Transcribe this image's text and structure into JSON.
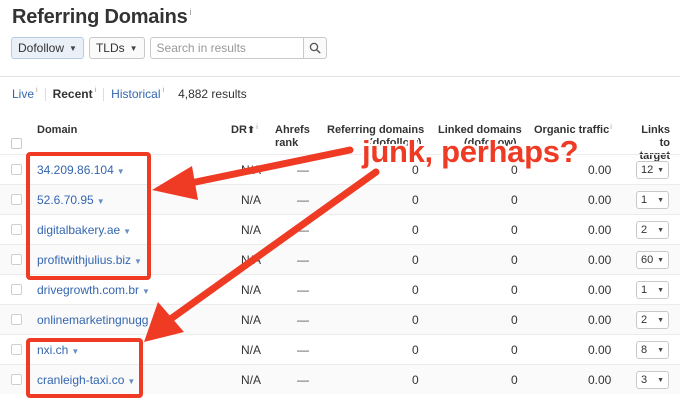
{
  "header": {
    "title": "Referring Domains",
    "info": "i"
  },
  "filters": {
    "dofollow_label": "Dofollow",
    "tlds_label": "TLDs",
    "search_placeholder": "Search in results"
  },
  "modes": {
    "live": "Live",
    "recent": "Recent",
    "historical": "Historical",
    "info": "i",
    "results": "4,882 results"
  },
  "columns": {
    "domain": "Domain",
    "dr": "DR",
    "ahrefs_rank": [
      "Ahrefs",
      "rank"
    ],
    "referring_domains": [
      "Referring domains",
      "(dofollow)"
    ],
    "linked_domains": [
      "Linked domains",
      "(dofollow)"
    ],
    "organic_traffic": "Organic traffic",
    "links_to_target": [
      "Links to",
      "target"
    ]
  },
  "rows": [
    {
      "domain": "34.209.86.104",
      "dr": "N/A",
      "rank": "—",
      "ref": "0",
      "linked": "0",
      "traffic": "0.00",
      "links": "12"
    },
    {
      "domain": "52.6.70.95",
      "dr": "N/A",
      "rank": "—",
      "ref": "0",
      "linked": "0",
      "traffic": "0.00",
      "links": "1"
    },
    {
      "domain": "digitalbakery.ae",
      "dr": "N/A",
      "rank": "—",
      "ref": "0",
      "linked": "0",
      "traffic": "0.00",
      "links": "2"
    },
    {
      "domain": "profitwithjulius.biz",
      "dr": "N/A",
      "rank": "—",
      "ref": "0",
      "linked": "0",
      "traffic": "0.00",
      "links": "60"
    },
    {
      "domain": "drivegrowth.com.br",
      "dr": "N/A",
      "rank": "—",
      "ref": "0",
      "linked": "0",
      "traffic": "0.00",
      "links": "1"
    },
    {
      "domain": "onlinemarketingnugg",
      "dr": "N/A",
      "rank": "—",
      "ref": "0",
      "linked": "0",
      "traffic": "0.00",
      "links": "2"
    },
    {
      "domain": "nxi.ch",
      "dr": "N/A",
      "rank": "—",
      "ref": "0",
      "linked": "0",
      "traffic": "0.00",
      "links": "8"
    },
    {
      "domain": "cranleigh-taxi.co",
      "dr": "N/A",
      "rank": "—",
      "ref": "0",
      "linked": "0",
      "traffic": "0.00",
      "links": "3"
    }
  ],
  "annotation": {
    "text": "junk, perhaps?"
  },
  "icons": {
    "info": "info-icon",
    "caret": "chevron-down-icon",
    "search": "search-icon",
    "sort": "sort-arrow-icon"
  },
  "colors": {
    "link": "#3466b0",
    "annotation": "#ef3a24",
    "text": "#333333"
  }
}
